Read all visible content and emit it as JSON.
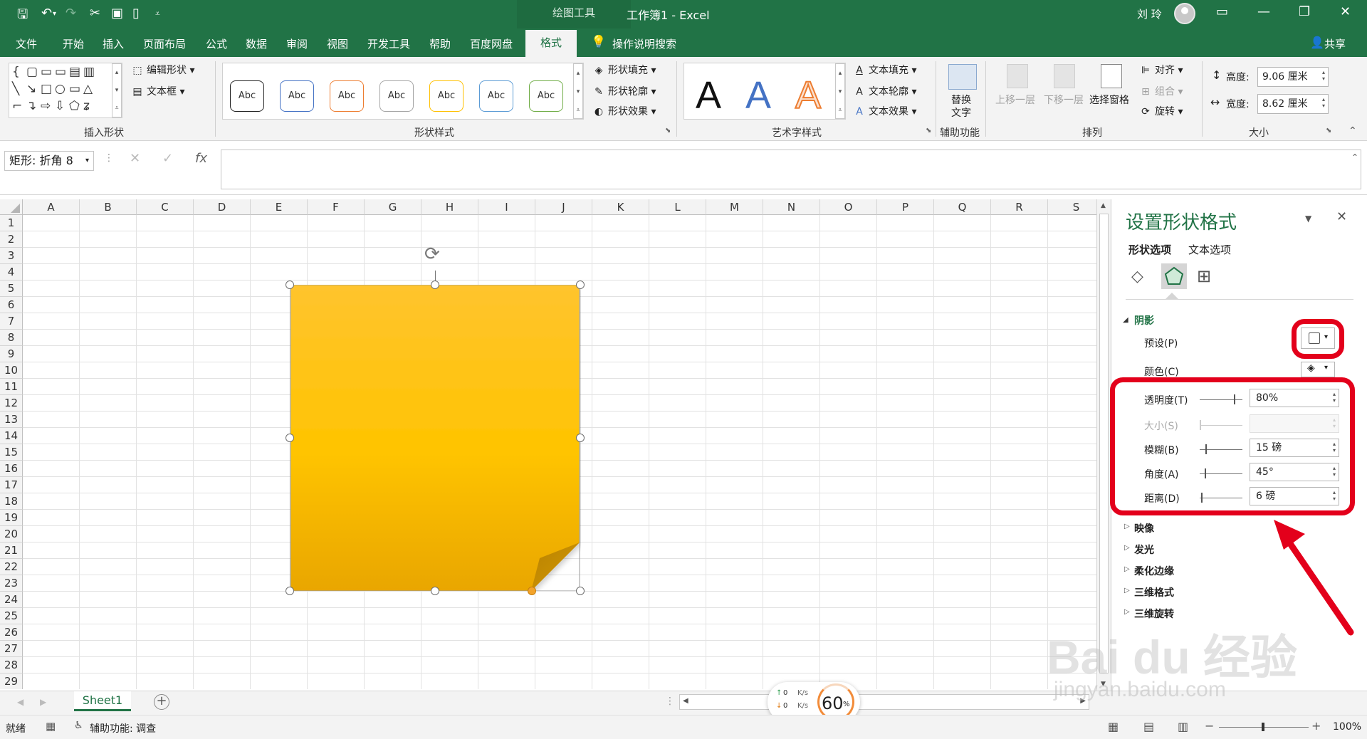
{
  "titlebar": {
    "context_tab": "绘图工具",
    "doc_title": "工作簿1  -  Excel",
    "user": "刘 玲"
  },
  "menu": [
    "文件",
    "开始",
    "插入",
    "页面布局",
    "公式",
    "数据",
    "审阅",
    "视图",
    "开发工具",
    "帮助",
    "百度网盘",
    "格式"
  ],
  "tell_me": "操作说明搜索",
  "share": "共享",
  "ribbon": {
    "insert_shapes": {
      "edit_shape": "编辑形状",
      "textbox": "文本框",
      "label": "插入形状"
    },
    "shape_styles": {
      "swatch_text": "Abc",
      "fill": "形状填充",
      "outline": "形状轮廓",
      "effects": "形状效果",
      "label": "形状样式"
    },
    "wordart": {
      "letter": "A",
      "text_fill": "文本填充",
      "text_outline": "文本轮廓",
      "text_effects": "文本效果",
      "label": "艺术字样式"
    },
    "accessibility": {
      "alt_text_1": "替换",
      "alt_text_2": "文字",
      "label": "辅助功能"
    },
    "arrange": {
      "bring_forward": "上移一层",
      "send_backward": "下移一层",
      "selection_pane": "选择窗格",
      "align": "对齐",
      "group": "组合",
      "rotate": "旋转",
      "label": "排列"
    },
    "size": {
      "height_label": "高度:",
      "height_value": "9.06 厘米",
      "width_label": "宽度:",
      "width_value": "8.62 厘米",
      "label": "大小"
    }
  },
  "formula_bar": {
    "name_box": "矩形: 折角 8",
    "fx": "fx"
  },
  "columns": [
    "A",
    "B",
    "C",
    "D",
    "E",
    "F",
    "G",
    "H",
    "I",
    "J",
    "K",
    "L",
    "M",
    "N",
    "O",
    "P",
    "Q",
    "R",
    "S"
  ],
  "rows": [
    "1",
    "2",
    "3",
    "4",
    "5",
    "6",
    "7",
    "8",
    "9",
    "10",
    "11",
    "12",
    "13",
    "14",
    "15",
    "16",
    "17",
    "18",
    "19",
    "20",
    "21",
    "22",
    "23",
    "24",
    "25",
    "26",
    "27",
    "28",
    "29"
  ],
  "sheet_tab": "Sheet1",
  "status": {
    "ready": "就绪",
    "accessibility": "辅助功能: 调查",
    "zoom": "100%"
  },
  "net_widget": {
    "up": "0",
    "down": "0",
    "unit": "K/s",
    "percent": "60",
    "percent_sign": "%"
  },
  "pane": {
    "title": "设置形状格式",
    "tab_shape": "形状选项",
    "tab_text": "文本选项",
    "section_shadow": "阴影",
    "preset_label": "预设(P)",
    "color_label": "颜色(C)",
    "transparency_label": "透明度(T)",
    "transparency_value": "80%",
    "size_label": "大小(S)",
    "blur_label": "模糊(B)",
    "blur_value": "15 磅",
    "angle_label": "角度(A)",
    "angle_value": "45°",
    "distance_label": "距离(D)",
    "distance_value": "6 磅",
    "sections": [
      "映像",
      "发光",
      "柔化边缘",
      "三维格式",
      "三维旋转"
    ]
  },
  "watermark": {
    "main": "Bai du 经验",
    "sub": "jingyan.baidu.com"
  },
  "colors": {
    "excel_green": "#217346",
    "shape_gold": "#f7b800",
    "highlight_red": "#e3001b"
  }
}
